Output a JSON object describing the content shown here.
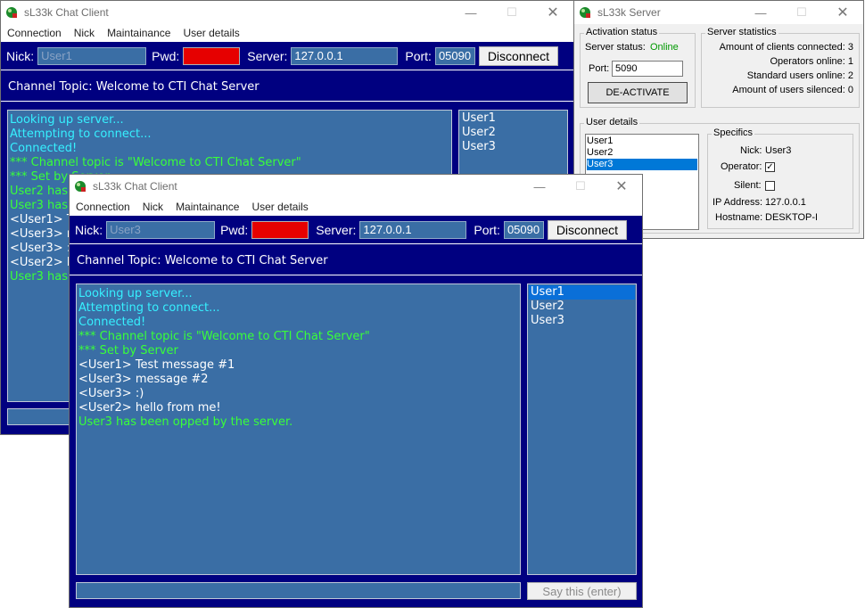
{
  "back_client": {
    "title": "sL33k Chat Client",
    "menu": [
      "Connection",
      "Nick",
      "Maintainance",
      "User details"
    ],
    "toolbar": {
      "nick_label": "Nick:",
      "nick_value": "User1",
      "pwd_label": "Pwd:",
      "server_label": "Server:",
      "server_value": "127.0.0.1",
      "port_label": "Port:",
      "port_value": "05090",
      "disconnect_label": "Disconnect"
    },
    "topic": "Channel Topic: Welcome to CTI Chat Server",
    "log": [
      {
        "text": "Looking up server...",
        "color": "cyan"
      },
      {
        "text": "Attempting to connect...",
        "color": "cyan"
      },
      {
        "text": "Connected!",
        "color": "cyan"
      },
      {
        "text": "*** Channel topic is \"Welcome to CTI Chat Server\"",
        "color": "green"
      },
      {
        "text": "*** Set by Server",
        "color": "green"
      },
      {
        "text": "User2 has",
        "color": "green"
      },
      {
        "text": "User3 has",
        "color": "green"
      },
      {
        "text": "<User1> T",
        "color": "white"
      },
      {
        "text": "<User3> m",
        "color": "white"
      },
      {
        "text": "<User3> :",
        "color": "white"
      },
      {
        "text": "<User2> h",
        "color": "white"
      },
      {
        "text": "User3 has",
        "color": "green"
      }
    ],
    "users": [
      "User1",
      "User2",
      "User3"
    ]
  },
  "front_client": {
    "title": "sL33k Chat Client",
    "menu": [
      "Connection",
      "Nick",
      "Maintainance",
      "User details"
    ],
    "toolbar": {
      "nick_label": "Nick:",
      "nick_value": "User3",
      "pwd_label": "Pwd:",
      "server_label": "Server:",
      "server_value": "127.0.0.1",
      "port_label": "Port:",
      "port_value": "05090",
      "disconnect_label": "Disconnect"
    },
    "topic": "Channel Topic: Welcome to CTI Chat Server",
    "log": [
      {
        "text": "Looking up server...",
        "color": "cyan"
      },
      {
        "text": "Attempting to connect...",
        "color": "cyan"
      },
      {
        "text": "Connected!",
        "color": "cyan"
      },
      {
        "text": "*** Channel topic is \"Welcome to CTI Chat Server\"",
        "color": "green"
      },
      {
        "text": "*** Set by Server",
        "color": "green"
      },
      {
        "text": "<User1> Test message #1",
        "color": "white"
      },
      {
        "text": "<User3> message #2",
        "color": "white"
      },
      {
        "text": "<User3> :)",
        "color": "white"
      },
      {
        "text": "<User2> hello from me!",
        "color": "white"
      },
      {
        "text": "User3 has been opped by the server.",
        "color": "green"
      }
    ],
    "users": [
      "User1",
      "User2",
      "User3"
    ],
    "selected_user": "User1",
    "say_input_value": "",
    "say_button_label": "Say this (enter)"
  },
  "server": {
    "title": "sL33k Server",
    "activation": {
      "legend": "Activation status",
      "status_label": "Server status:",
      "status_value": "Online",
      "port_label": "Port:",
      "port_value": "5090",
      "button_label": "DE-ACTIVATE"
    },
    "stats": {
      "legend": "Server statistics",
      "lines": [
        "Amount of clients connected: 3",
        "Operators online: 1",
        "Standard users online: 2",
        "Amount of users silenced: 0"
      ]
    },
    "user_details": {
      "legend": "User details",
      "users": [
        "User1",
        "User2",
        "User3"
      ],
      "selected_user": "User3"
    },
    "specifics": {
      "legend": "Specifics",
      "nick_label": "Nick:",
      "nick_value": "User3",
      "operator_label": "Operator:",
      "operator_checked": true,
      "silent_label": "Silent:",
      "silent_checked": false,
      "ip_label": "IP Address:",
      "ip_value": "127.0.0.1",
      "hostname_label": "Hostname:",
      "hostname_value": "DESKTOP-I"
    }
  },
  "colors": {
    "navy": "#000080",
    "panel_blue": "#3a6ea5",
    "cyan": "#36f0ff",
    "green": "#39ff39",
    "online_green": "#009900"
  }
}
